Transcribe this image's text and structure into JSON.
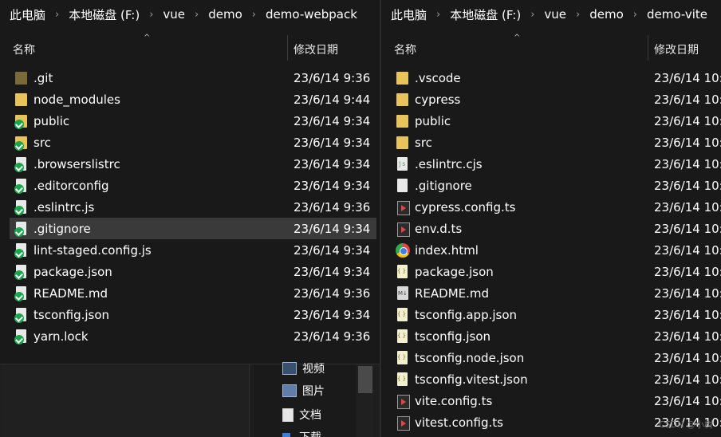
{
  "left": {
    "breadcrumb": [
      "此电脑",
      "本地磁盘 (F:)",
      "vue",
      "demo",
      "demo-webpack"
    ],
    "columns": {
      "name": "名称",
      "date": "修改日期"
    },
    "items": [
      {
        "name": ".git",
        "date": "23/6/14 9:36",
        "icon": "folder-dark-icon"
      },
      {
        "name": "node_modules",
        "date": "23/6/14 9:44",
        "icon": "folder-icon"
      },
      {
        "name": "public",
        "date": "23/6/14 9:34",
        "icon": "folder-synced-icon"
      },
      {
        "name": "src",
        "date": "23/6/14 9:34",
        "icon": "folder-synced-icon"
      },
      {
        "name": ".browserslistrc",
        "date": "23/6/14 9:34",
        "icon": "file-synced-icon"
      },
      {
        "name": ".editorconfig",
        "date": "23/6/14 9:34",
        "icon": "file-synced-icon"
      },
      {
        "name": ".eslintrc.js",
        "date": "23/6/14 9:36",
        "icon": "file-synced-icon"
      },
      {
        "name": ".gitignore",
        "date": "23/6/14 9:34",
        "icon": "file-synced-icon"
      },
      {
        "name": "lint-staged.config.js",
        "date": "23/6/14 9:34",
        "icon": "file-synced-icon"
      },
      {
        "name": "package.json",
        "date": "23/6/14 9:34",
        "icon": "file-synced-icon"
      },
      {
        "name": "README.md",
        "date": "23/6/14 9:36",
        "icon": "file-synced-icon"
      },
      {
        "name": "tsconfig.json",
        "date": "23/6/14 9:34",
        "icon": "file-synced-icon"
      },
      {
        "name": "yarn.lock",
        "date": "23/6/14 9:36",
        "icon": "file-synced-icon"
      }
    ],
    "selected_index": 7
  },
  "right": {
    "breadcrumb": [
      "此电脑",
      "本地磁盘 (F:)",
      "vue",
      "demo",
      "demo-vite"
    ],
    "columns": {
      "name": "名称",
      "date": "修改日期"
    },
    "items": [
      {
        "name": ".vscode",
        "date": "23/6/14 10:",
        "icon": "folder-icon"
      },
      {
        "name": "cypress",
        "date": "23/6/14 10:",
        "icon": "folder-icon"
      },
      {
        "name": "public",
        "date": "23/6/14 10:",
        "icon": "folder-icon"
      },
      {
        "name": "src",
        "date": "23/6/14 10:",
        "icon": "folder-icon"
      },
      {
        "name": ".eslintrc.cjs",
        "date": "23/6/14 10:",
        "icon": "js-file-icon"
      },
      {
        "name": ".gitignore",
        "date": "23/6/14 10:",
        "icon": "text-file-icon"
      },
      {
        "name": "cypress.config.ts",
        "date": "23/6/14 10:",
        "icon": "ts-file-icon"
      },
      {
        "name": "env.d.ts",
        "date": "23/6/14 10:",
        "icon": "ts-file-icon"
      },
      {
        "name": "index.html",
        "date": "23/6/14 10:",
        "icon": "chrome-icon"
      },
      {
        "name": "package.json",
        "date": "23/6/14 10:",
        "icon": "json-file-icon"
      },
      {
        "name": "README.md",
        "date": "23/6/14 10:",
        "icon": "markdown-file-icon"
      },
      {
        "name": "tsconfig.app.json",
        "date": "23/6/14 10:",
        "icon": "json-file-icon"
      },
      {
        "name": "tsconfig.json",
        "date": "23/6/14 10:",
        "icon": "json-file-icon"
      },
      {
        "name": "tsconfig.node.json",
        "date": "23/6/14 10:",
        "icon": "json-file-icon"
      },
      {
        "name": "tsconfig.vitest.json",
        "date": "23/6/14 10:",
        "icon": "json-file-icon"
      },
      {
        "name": "vite.config.ts",
        "date": "23/6/14 10:",
        "icon": "ts-file-icon"
      },
      {
        "name": "vitest.config.ts",
        "date": "23/6/14 10:",
        "icon": "ts-file-icon"
      }
    ]
  },
  "background_nav": [
    "视频",
    "图片",
    "文档",
    "下载"
  ],
  "watermark": "CSDN @小树"
}
